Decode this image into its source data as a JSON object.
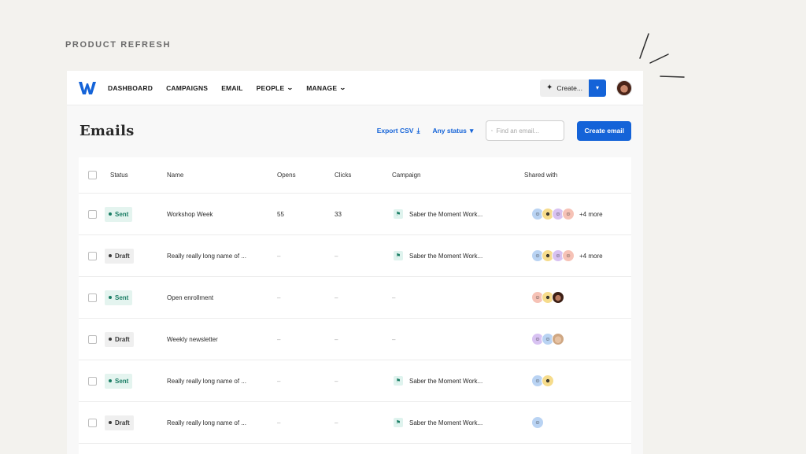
{
  "eyebrow": "PRODUCT REFRESH",
  "colors": {
    "accent": "#1463d8",
    "sent": "#1a7d64",
    "draft": "#3a3a3a",
    "background": "#f3f2ee"
  },
  "nav": {
    "logo": "W",
    "items": [
      {
        "label": "DASHBOARD",
        "dropdown": false
      },
      {
        "label": "CAMPAIGNS",
        "dropdown": false
      },
      {
        "label": "EMAIL",
        "dropdown": false
      },
      {
        "label": "PEOPLE",
        "dropdown": true
      },
      {
        "label": "MANAGE",
        "dropdown": true
      }
    ],
    "create_label": "Create...",
    "create_icon": "sparkle-icon",
    "caret_icon": "chevron-down-icon",
    "avatar_icon": "user-avatar"
  },
  "toolbar": {
    "title": "Emails",
    "export_label": "Export CSV",
    "export_icon": "download-icon",
    "status_label": "Any status",
    "status_icon": "chevron-down-icon",
    "search_placeholder": "Find an email...",
    "search_icon": "search-icon",
    "create_email_label": "Create email"
  },
  "table": {
    "headers": {
      "status": "Status",
      "name": "Name",
      "opens": "Opens",
      "clicks": "Clicks",
      "campaign": "Campaign",
      "shared": "Shared with"
    },
    "rows": [
      {
        "status": "Sent",
        "name": "Workshop Week",
        "opens": "55",
        "clicks": "33",
        "campaign": "Saber the Moment Work...",
        "has_campaign": true,
        "avatars": [
          "blue",
          "yellow",
          "purple",
          "pink"
        ],
        "more": "+4 more"
      },
      {
        "status": "Draft",
        "name": "Really really long name of ...",
        "opens": "–",
        "clicks": "–",
        "campaign": "Saber the Moment Work...",
        "has_campaign": true,
        "avatars": [
          "blue",
          "yellow",
          "purple",
          "pink"
        ],
        "more": "+4 more"
      },
      {
        "status": "Sent",
        "name": "Open enrollment",
        "opens": "–",
        "clicks": "–",
        "campaign": "–",
        "has_campaign": false,
        "avatars": [
          "pink",
          "yellow",
          "photo-dark"
        ],
        "more": ""
      },
      {
        "status": "Draft",
        "name": "Weekly newsletter",
        "opens": "–",
        "clicks": "–",
        "campaign": "–",
        "has_campaign": false,
        "avatars": [
          "purple",
          "blue",
          "photo-light"
        ],
        "more": ""
      },
      {
        "status": "Sent",
        "name": "Really really long name of ...",
        "opens": "–",
        "clicks": "–",
        "campaign": "Saber the Moment Work...",
        "has_campaign": true,
        "avatars": [
          "blue",
          "yellow"
        ],
        "more": ""
      },
      {
        "status": "Draft",
        "name": "Really really long name of ...",
        "opens": "–",
        "clicks": "–",
        "campaign": "Saber the Moment Work...",
        "has_campaign": true,
        "avatars": [
          "blue"
        ],
        "more": ""
      }
    ]
  }
}
